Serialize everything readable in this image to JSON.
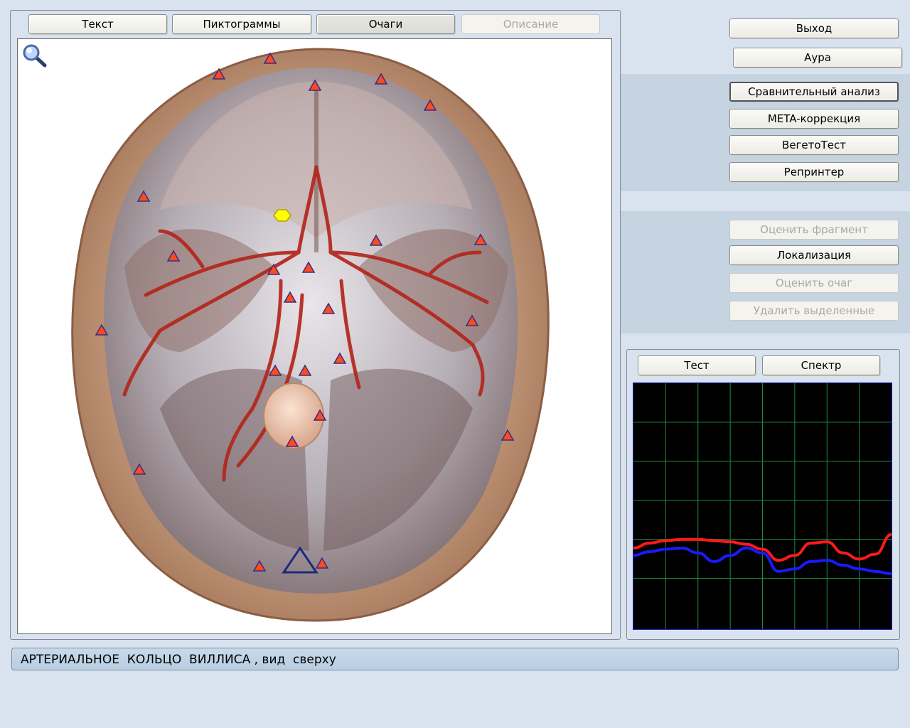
{
  "top_tabs": [
    {
      "label": "Текст",
      "state": "normal"
    },
    {
      "label": "Пиктограммы",
      "state": "normal"
    },
    {
      "label": "Очаги",
      "state": "active"
    },
    {
      "label": "Описание",
      "state": "disabled"
    }
  ],
  "right_menu": {
    "exit_label": "Выход",
    "aura_label": "Аура",
    "group1": [
      "Сравнительный анализ",
      "META-коррекция",
      "ВегетоТест",
      "Репринтер"
    ],
    "group2": [
      {
        "label": "Оценить фрагмент",
        "state": "disabled"
      },
      {
        "label": "Локализация",
        "state": "normal"
      },
      {
        "label": "Оценить очаг",
        "state": "disabled"
      },
      {
        "label": "Удалить выделенные",
        "state": "disabled"
      }
    ]
  },
  "graph_tabs": [
    "Тест",
    "Спектр"
  ],
  "caption": "АРТЕРИАЛЬНОЕ  КОЛЬЦО  ВИЛЛИСА , вид  сверху",
  "icons": [
    "magnifier-icon",
    "focus-marker-triangle",
    "selected-focus-hexagon"
  ],
  "colors": {
    "background": "#d8e3ef",
    "graph_background": "#000000",
    "graph_grid": "#1e8c3a",
    "series_red": "#ff1a1a",
    "series_blue": "#1a1aff",
    "marker_fill": "#ff4a1a",
    "marker_stroke": "#3a2a8a",
    "selected_marker": "#ffff00"
  },
  "chart_data": {
    "type": "line",
    "grid": true,
    "x": [
      0,
      1,
      2,
      3,
      4,
      5,
      6,
      7,
      8,
      9,
      10,
      11,
      12,
      13,
      14,
      15,
      16
    ],
    "xlim": [
      0,
      16
    ],
    "ylim": [
      0,
      1
    ],
    "series": [
      {
        "color": "#ff1a1a",
        "values": [
          0.33,
          0.35,
          0.36,
          0.365,
          0.365,
          0.36,
          0.355,
          0.345,
          0.325,
          0.28,
          0.3,
          0.35,
          0.355,
          0.31,
          0.285,
          0.305,
          0.385
        ]
      },
      {
        "color": "#1a1aff",
        "values": [
          0.3,
          0.315,
          0.325,
          0.33,
          0.31,
          0.275,
          0.3,
          0.33,
          0.31,
          0.235,
          0.245,
          0.275,
          0.28,
          0.26,
          0.245,
          0.235,
          0.225
        ]
      }
    ]
  }
}
